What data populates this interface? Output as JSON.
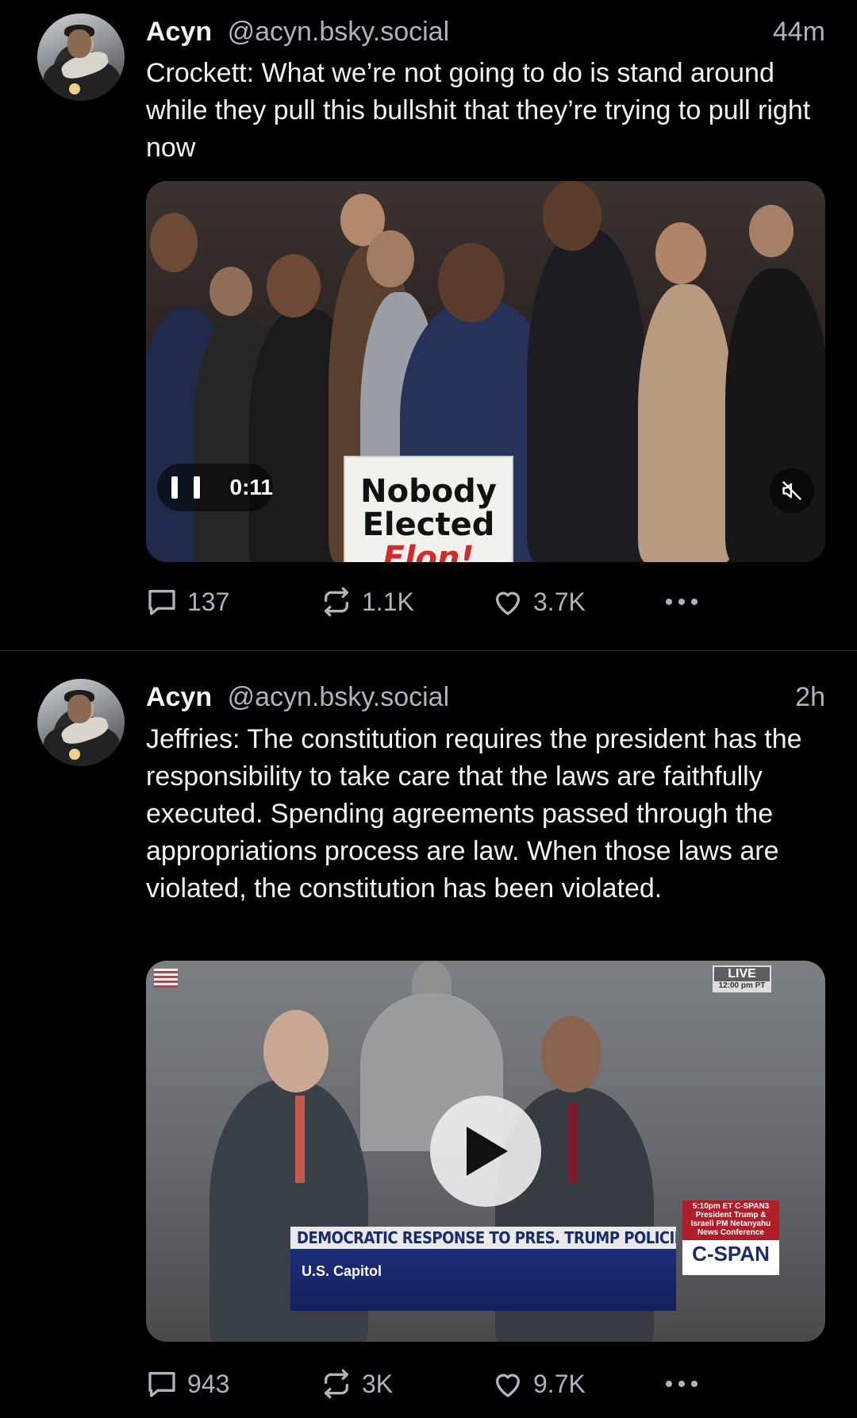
{
  "posts": [
    {
      "author_name": "Acyn",
      "author_handle": "@acyn.bsky.social",
      "time": "44m",
      "text": "Crockett: What we’re not going to do is stand around while they pull this bullshit that they’re trying to pull right now",
      "video": {
        "state": "playing",
        "duration": "0:11",
        "sign_line1": "Nobody",
        "sign_line2": "Elected",
        "sign_line3": "Elon!",
        "muted": true
      },
      "stats": {
        "replies": "137",
        "reposts": "1.1K",
        "likes": "3.7K"
      }
    },
    {
      "author_name": "Acyn",
      "author_handle": "@acyn.bsky.social",
      "time": "2h",
      "text": "Jeffries: The constitution requires the president has the responsibility to take care that the laws are faithfully executed. Spending agreements passed through the appropriations process are law. When those laws are violated, the constitution has been violated.",
      "video": {
        "state": "paused",
        "live_label": "LIVE",
        "live_time": "12:00 pm PT",
        "headline": "DEMOCRATIC RESPONSE TO PRES. TRUMP POLICIES",
        "location": "U.S. Capitol",
        "schedule_line1": "5:10pm ET C-SPAN3",
        "schedule_line2": "President Trump &",
        "schedule_line3": "Israeli PM Netanyahu",
        "schedule_line4": "News Conference",
        "network": "C-SPAN"
      },
      "stats": {
        "replies": "943",
        "reposts": "3K",
        "likes": "9.7K"
      }
    }
  ],
  "icons": {
    "reply": "speech-bubble-icon",
    "repost": "repost-arrows-icon",
    "like": "heart-icon",
    "more": "ellipsis-icon",
    "pause": "pause-icon",
    "mute": "speaker-muted-icon",
    "play": "play-icon"
  },
  "colors": {
    "background": "#000000",
    "text": "#f1f3f5",
    "muted_text": "#aeb4bb",
    "divider": "#23272b"
  }
}
